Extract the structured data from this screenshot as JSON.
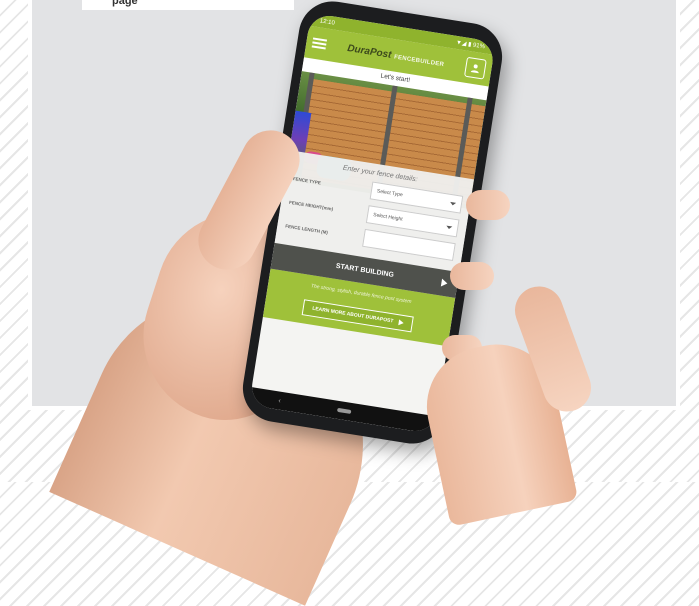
{
  "page": {
    "top_label": "page"
  },
  "phone": {
    "status_time": "12:10",
    "status_right": "▼◢ ▮ 91%",
    "app": {
      "logo_main": "DuraPost",
      "logo_sub": "FENCEBUILDER",
      "subtitle": "Let's start!"
    },
    "form": {
      "title": "Enter your fence details:",
      "fence_type_label": "FENCE TYPE",
      "fence_type_value": "Select Type",
      "fence_height_label": "FENCE HEIGHT(mm)",
      "fence_height_value": "Select Height",
      "fence_length_label": "FENCE LENGTH (M)",
      "fence_length_value": "",
      "start_button": "START BUILDING"
    },
    "footer": {
      "tagline": "The strong, stylish, durable fence post system",
      "learn_button": "LEARN MORE ABOUT DURAPOST"
    },
    "nav": {
      "back": "‹"
    }
  },
  "colors": {
    "brand_green": "#9fc13a",
    "dark_button": "#4f514c",
    "panel_bg": "#e2e3e5"
  }
}
